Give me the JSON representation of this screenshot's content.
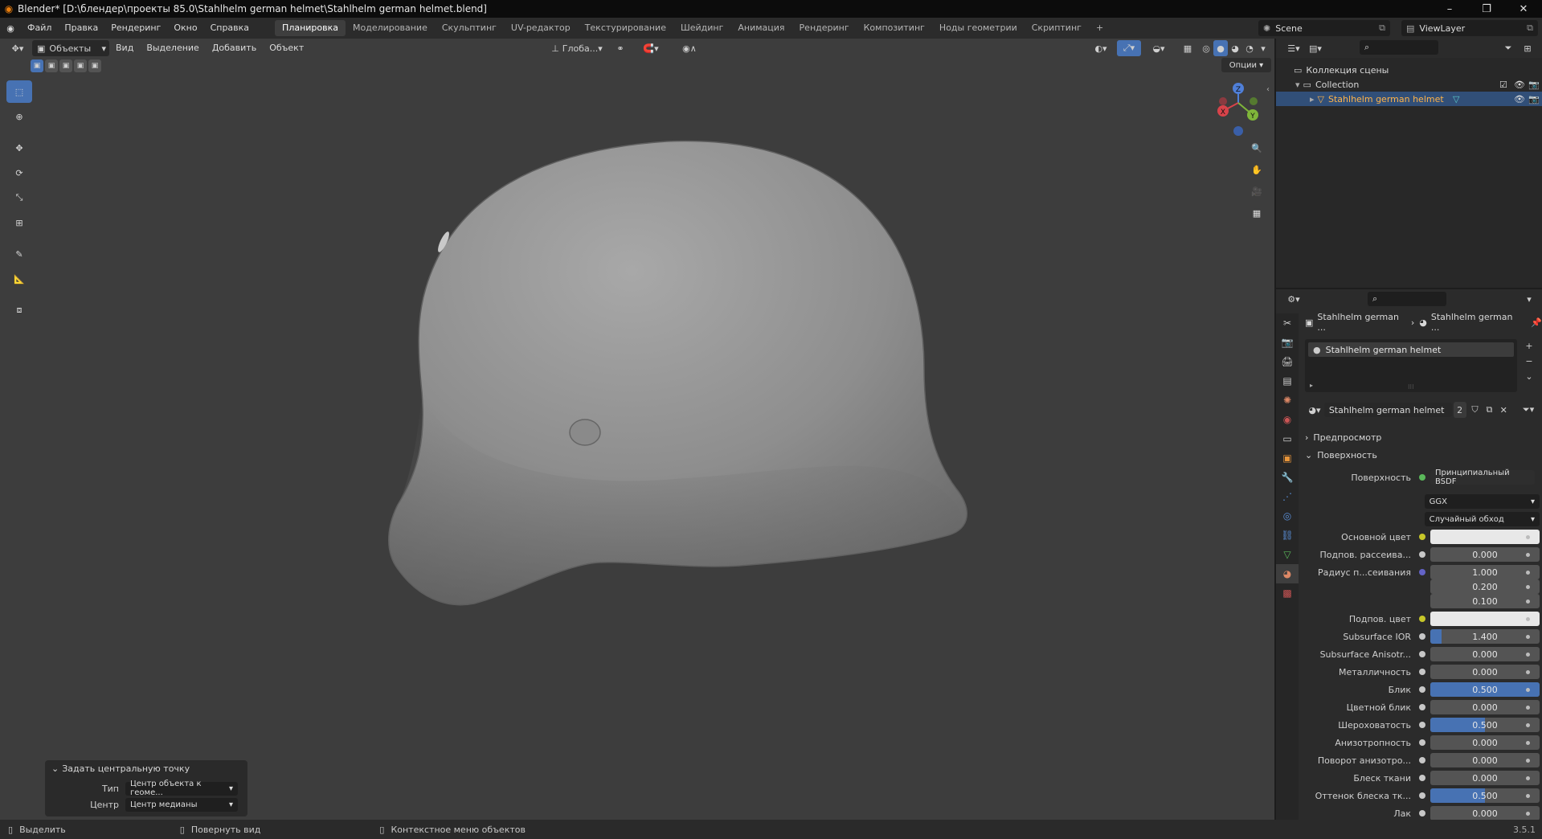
{
  "window": {
    "title": "Blender* [D:\\блендер\\проекты 85.0\\Stahlhelm german helmet\\Stahlhelm german helmet.blend]",
    "minimize": "–",
    "maximize": "❐",
    "close": "✕"
  },
  "menu": [
    "Файл",
    "Правка",
    "Рендеринг",
    "Окно",
    "Справка"
  ],
  "workspaces": [
    "Планировка",
    "Моделирование",
    "Скульптинг",
    "UV-редактор",
    "Текстурирование",
    "Шейдинг",
    "Анимация",
    "Рендеринг",
    "Композитинг",
    "Ноды геометрии",
    "Скриптинг"
  ],
  "workspace_add": "+",
  "scene": {
    "name": "Scene",
    "view_layer": "ViewLayer"
  },
  "viewport_header": {
    "mode": "Объекты",
    "menus": [
      "Вид",
      "Выделение",
      "Добавить",
      "Объект"
    ],
    "transform_orientation": "Глоба...",
    "options_label": "Опции"
  },
  "gizmo": {
    "x": "X",
    "y": "Y",
    "z": "Z"
  },
  "operator_panel": {
    "title": "Задать центральную точку",
    "type_label": "Тип",
    "type_value": "Центр объекта к геоме...",
    "center_label": "Центр",
    "center_value": "Центр медианы"
  },
  "status_bar": {
    "left": "Выделить",
    "middle": "Повернуть вид",
    "right": "Контекстное меню объектов",
    "version": "3.5.1"
  },
  "outliner": {
    "scene_collection": "Коллекция сцены",
    "collection": "Collection",
    "object": "Stahlhelm german helmet"
  },
  "properties": {
    "breadcrumb_object": "Stahlhelm german ...",
    "breadcrumb_material": "Stahlhelm german ...",
    "material_slot": "Stahlhelm german helmet",
    "material_name": "Stahlhelm german helmet",
    "user_count": "2",
    "sections": {
      "preview": "Предпросмотр",
      "surface": "Поверхность"
    },
    "surface_label": "Поверхность",
    "surface_shader": "Принципиальный BSDF",
    "distribution": "GGX",
    "subsurface_method": "Случайный обход",
    "rows": [
      {
        "label": "Основной цвет",
        "kind": "color",
        "color": "#e8e8e8",
        "dot": "yel"
      },
      {
        "label": "Подпов. рассеива...",
        "value": "0.000",
        "fill": 0,
        "dot": "gray"
      },
      {
        "label": "Радиус п...сеивания",
        "value": "1.000",
        "fill": 0,
        "dot": "blu"
      },
      {
        "label": "",
        "value": "0.200",
        "fill": 0,
        "dot": "none"
      },
      {
        "label": "",
        "value": "0.100",
        "fill": 0,
        "dot": "none"
      },
      {
        "label": "Подпов. цвет",
        "kind": "color",
        "color": "#e8e8e8",
        "dot": "yel"
      },
      {
        "label": "Subsurface IOR",
        "value": "1.400",
        "fill": 0.1,
        "dot": "gray"
      },
      {
        "label": "Subsurface Anisotr...",
        "value": "0.000",
        "fill": 0,
        "dot": "gray"
      },
      {
        "label": "Металличность",
        "value": "0.000",
        "fill": 0,
        "dot": "gray"
      },
      {
        "label": "Блик",
        "value": "0.500",
        "fill": 1,
        "dot": "gray"
      },
      {
        "label": "Цветной блик",
        "value": "0.000",
        "fill": 0,
        "dot": "gray"
      },
      {
        "label": "Шероховатость",
        "value": "0.500",
        "fill": 0.5,
        "dot": "gray"
      },
      {
        "label": "Анизотропность",
        "value": "0.000",
        "fill": 0,
        "dot": "gray"
      },
      {
        "label": "Поворот анизотро...",
        "value": "0.000",
        "fill": 0,
        "dot": "gray"
      },
      {
        "label": "Блеск ткани",
        "value": "0.000",
        "fill": 0,
        "dot": "gray"
      },
      {
        "label": "Оттенок блеска тк...",
        "value": "0.500",
        "fill": 0.5,
        "dot": "gray"
      },
      {
        "label": "Лак",
        "value": "0.000",
        "fill": 0,
        "dot": "gray"
      }
    ]
  },
  "colors": {
    "accent": "#4772b3",
    "selected_object": "#ffb34a",
    "viewport_bg": "#3d3d3d"
  }
}
